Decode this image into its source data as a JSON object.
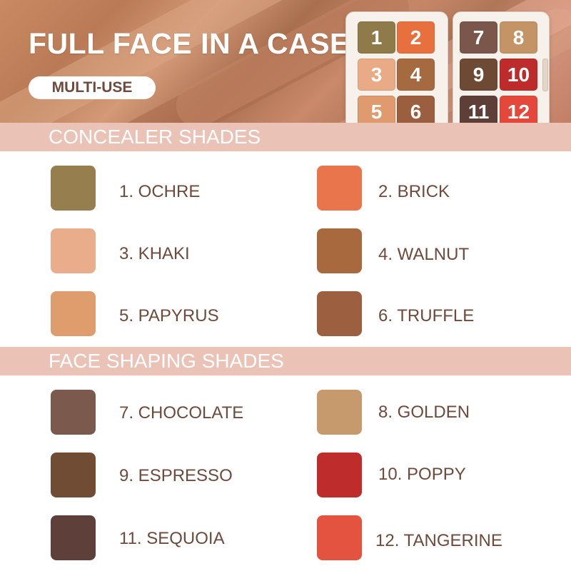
{
  "header": {
    "title": "FULL FACE IN A CASE",
    "badge": "MULTI-USE"
  },
  "palette_pans": [
    {
      "number": "1",
      "color": "#8f7b4a"
    },
    {
      "number": "2",
      "color": "#e8703f"
    },
    {
      "number": "3",
      "color": "#e9ab86"
    },
    {
      "number": "4",
      "color": "#a56a40"
    },
    {
      "number": "5",
      "color": "#df9b6d"
    },
    {
      "number": "6",
      "color": "#9b5e3f"
    },
    {
      "number": "7",
      "color": "#7a574a"
    },
    {
      "number": "8",
      "color": "#c49366"
    },
    {
      "number": "9",
      "color": "#6e4a34"
    },
    {
      "number": "10",
      "color": "#be2b2b"
    },
    {
      "number": "11",
      "color": "#5e3f38"
    },
    {
      "number": "12",
      "color": "#e5483a"
    }
  ],
  "concealer": {
    "heading": "CONCEALER SHADES",
    "shades": [
      {
        "label": "1. OCHRE",
        "color": "#977e4f"
      },
      {
        "label": "2. BRICK",
        "color": "#e8754b"
      },
      {
        "label": "3. KHAKI",
        "color": "#eaad8b"
      },
      {
        "label": "4. WALNUT",
        "color": "#a8693e"
      },
      {
        "label": "5. PAPYRUS",
        "color": "#df9d6e"
      },
      {
        "label": "6. TRUFFLE",
        "color": "#9c5f3f"
      }
    ]
  },
  "shaping": {
    "heading": "FACE SHAPING SHADES",
    "shades": [
      {
        "label": "7. CHOCOLATE",
        "color": "#7b5a4d"
      },
      {
        "label": "8. GOLDEN",
        "color": "#c79a6e"
      },
      {
        "label": "9. ESPRESSO",
        "color": "#704c35"
      },
      {
        "label": "10. POPPY",
        "color": "#be2c2c"
      },
      {
        "label": "11. SEQUOIA",
        "color": "#5f3f39"
      },
      {
        "label": "12. TANGERINE",
        "color": "#e4533f"
      }
    ]
  }
}
